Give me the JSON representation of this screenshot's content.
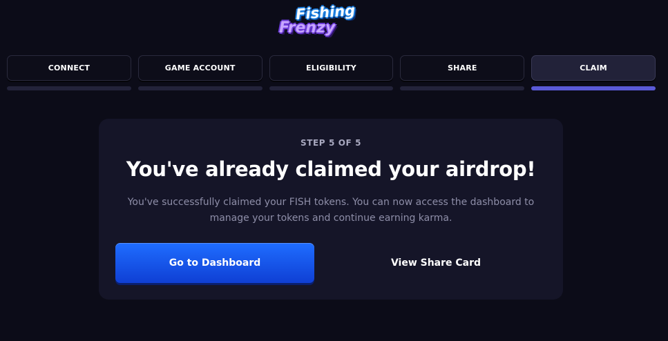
{
  "logo": {
    "line1": "Fishing",
    "line2": "Frenzy"
  },
  "steps": [
    {
      "label": "CONNECT",
      "active": false
    },
    {
      "label": "GAME ACCOUNT",
      "active": false
    },
    {
      "label": "ELIGIBILITY",
      "active": false
    },
    {
      "label": "SHARE",
      "active": false
    },
    {
      "label": "CLAIM",
      "active": true
    }
  ],
  "card": {
    "step_count": "STEP 5 OF 5",
    "title": "You've already claimed your airdrop!",
    "description": "You've successfully claimed your FISH tokens. You can now access the dashboard to manage your tokens and continue earning karma.",
    "primary_button": "Go to Dashboard",
    "secondary_button": "View Share Card"
  },
  "colors": {
    "background": "#0c0c18",
    "card": "#151528",
    "accent_blue": "#1f6dff",
    "progress_active": "#5a5ad6",
    "progress_inactive": "#23233a"
  }
}
